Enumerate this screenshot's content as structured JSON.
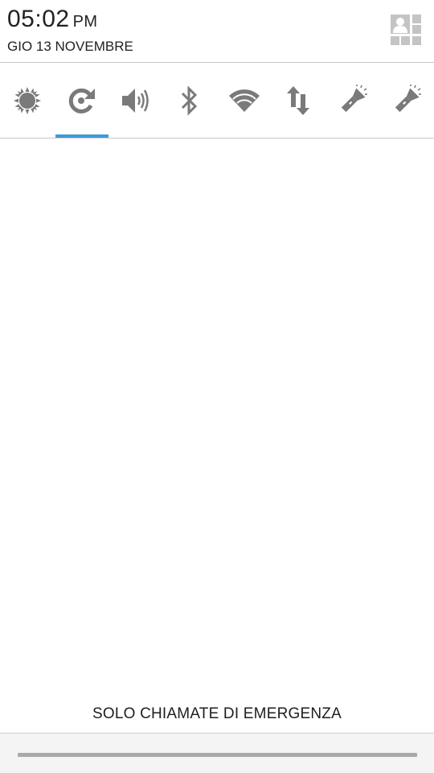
{
  "header": {
    "time": "05:02",
    "ampm": "PM",
    "date": "GIO 13 NOVEMBRE",
    "settings_icon": "quick-settings-user-icon"
  },
  "toggles": [
    {
      "icon": "brightness-icon",
      "active": false
    },
    {
      "icon": "auto-rotate-icon",
      "active": true
    },
    {
      "icon": "sound-icon",
      "active": false
    },
    {
      "icon": "bluetooth-icon",
      "active": false
    },
    {
      "icon": "wifi-icon",
      "active": false
    },
    {
      "icon": "mobile-data-icon",
      "active": false
    },
    {
      "icon": "flashlight-icon",
      "active": false
    },
    {
      "icon": "flashlight-icon",
      "active": false
    }
  ],
  "footer": {
    "emergency_text": "SOLO CHIAMATE DI EMERGENZA"
  },
  "colors": {
    "accent": "#3d9ad9",
    "icon": "#7a7a7a",
    "divider": "#c8c8c8"
  }
}
